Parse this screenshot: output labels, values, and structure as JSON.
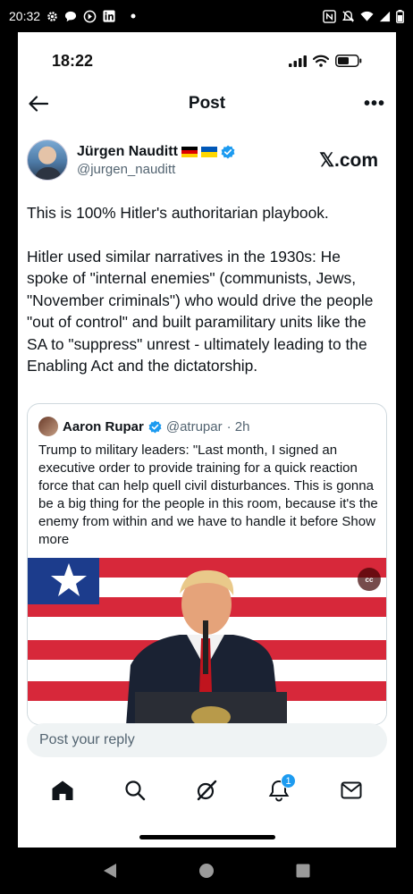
{
  "android_status": {
    "time": "20:32",
    "icons": [
      "gear-icon",
      "chat-bubble-icon",
      "accessibility-icon",
      "linkedin-icon",
      "dot-icon",
      "nfc-icon",
      "mute-icon",
      "wifi-icon",
      "signal-icon",
      "battery-icon"
    ]
  },
  "ios_status": {
    "time": "18:22"
  },
  "header": {
    "title": "Post",
    "back_icon": "arrow-left-icon",
    "more_label": "•••"
  },
  "author": {
    "name": "Jürgen Nauditt",
    "flags": [
      "german-flag-icon",
      "ukraine-flag-icon"
    ],
    "verified_icon": "verified-badge-icon",
    "handle": "@jurgen_nauditt",
    "brand": "𝕏.com"
  },
  "post": {
    "paragraph_1": "This is 100% Hitler's authoritarian playbook.",
    "paragraph_2": "Hitler used similar narratives in the 1930s: He spoke of \"internal enemies\" (communists, Jews, \"November criminals\") who would drive the people \"out of control\" and built paramilitary units like the SA to \"suppress\" unrest - ultimately leading to the Enabling Act and the dictatorship."
  },
  "quote": {
    "name": "Aaron Rupar",
    "handle": "@atrupar",
    "time": "· 2h",
    "text": "Trump to military leaders: \"Last month, I signed an executive order to provide training for a quick reaction force that can help quell civil disturbances. This is gonna be a big thing for the people in this room, because it's the enemy from within and we have to handle it before",
    "show_more": "Show more",
    "media_cc": "cc"
  },
  "reply": {
    "placeholder": "Post your reply"
  },
  "tabbar": {
    "items": [
      "home-icon",
      "search-icon",
      "grok-icon",
      "notifications-icon",
      "messages-icon"
    ],
    "notification_badge": "1"
  },
  "android_nav": [
    "back-triangle-icon",
    "home-circle-icon",
    "recents-square-icon"
  ],
  "colors": {
    "accent": "#1d9bf0",
    "text": "#0f1419",
    "secondary": "#536471",
    "reply_bg": "#eff3f4"
  }
}
